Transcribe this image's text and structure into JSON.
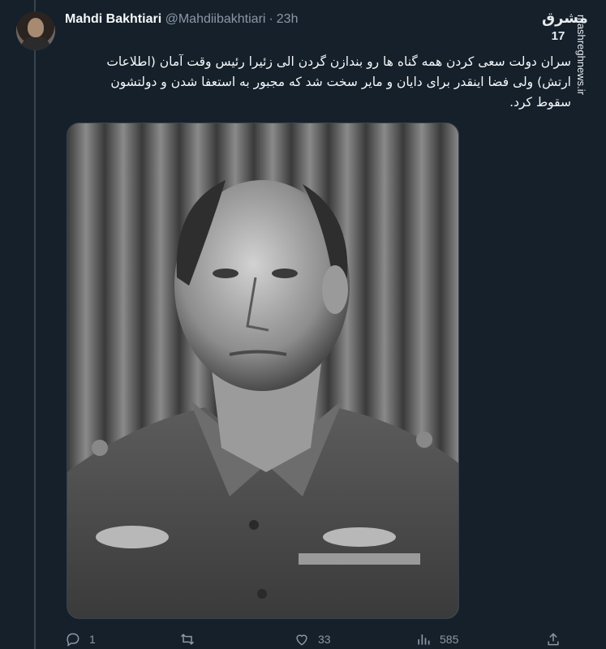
{
  "tweet": {
    "author_name": "Mahdi Bakhtiari",
    "author_handle": "@Mahdiibakhtiari",
    "separator": "·",
    "time": "23h",
    "text": "سران دولت سعی کردن همه گناه ها رو بندازن گردن الی زئیرا رئیس وقت آمان (اطلاعات ارتش) ولی فضا اینقدر برای دایان و مایر سخت شد که مجبور به استعفا شدن و دولتشون سقوط کرد."
  },
  "watermark": {
    "logo_text": "مشرق",
    "number": "17",
    "site": "mashreghnews.ir"
  },
  "actions": {
    "reply_count": "1",
    "retweet_count": "",
    "like_count": "33",
    "views_count": "585"
  },
  "icons": {
    "reply": "reply-icon",
    "retweet": "retweet-icon",
    "like": "heart-icon",
    "views": "views-icon",
    "share": "share-icon"
  },
  "colors": {
    "background": "#15202b",
    "text": "#f7f9f9",
    "muted": "#8b98a5",
    "border": "#38444d"
  }
}
